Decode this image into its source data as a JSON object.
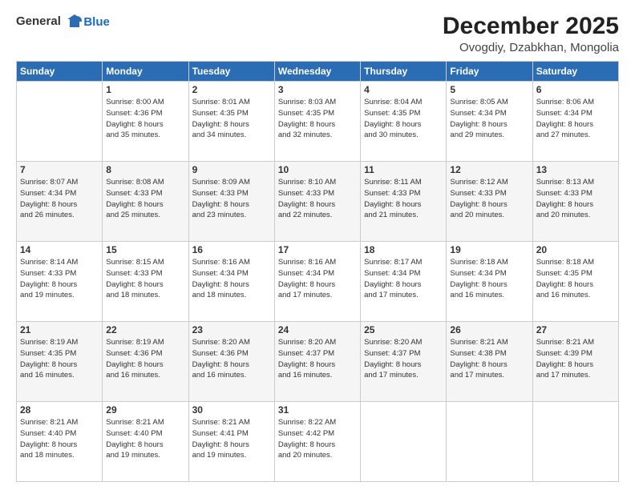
{
  "logo": {
    "general": "General",
    "blue": "Blue"
  },
  "header": {
    "month": "December 2025",
    "location": "Ovogdiy, Dzabkhan, Mongolia"
  },
  "weekdays": [
    "Sunday",
    "Monday",
    "Tuesday",
    "Wednesday",
    "Thursday",
    "Friday",
    "Saturday"
  ],
  "weeks": [
    [
      {
        "day": "",
        "info": ""
      },
      {
        "day": "1",
        "info": "Sunrise: 8:00 AM\nSunset: 4:36 PM\nDaylight: 8 hours\nand 35 minutes."
      },
      {
        "day": "2",
        "info": "Sunrise: 8:01 AM\nSunset: 4:35 PM\nDaylight: 8 hours\nand 34 minutes."
      },
      {
        "day": "3",
        "info": "Sunrise: 8:03 AM\nSunset: 4:35 PM\nDaylight: 8 hours\nand 32 minutes."
      },
      {
        "day": "4",
        "info": "Sunrise: 8:04 AM\nSunset: 4:35 PM\nDaylight: 8 hours\nand 30 minutes."
      },
      {
        "day": "5",
        "info": "Sunrise: 8:05 AM\nSunset: 4:34 PM\nDaylight: 8 hours\nand 29 minutes."
      },
      {
        "day": "6",
        "info": "Sunrise: 8:06 AM\nSunset: 4:34 PM\nDaylight: 8 hours\nand 27 minutes."
      }
    ],
    [
      {
        "day": "7",
        "info": "Sunrise: 8:07 AM\nSunset: 4:34 PM\nDaylight: 8 hours\nand 26 minutes."
      },
      {
        "day": "8",
        "info": "Sunrise: 8:08 AM\nSunset: 4:33 PM\nDaylight: 8 hours\nand 25 minutes."
      },
      {
        "day": "9",
        "info": "Sunrise: 8:09 AM\nSunset: 4:33 PM\nDaylight: 8 hours\nand 23 minutes."
      },
      {
        "day": "10",
        "info": "Sunrise: 8:10 AM\nSunset: 4:33 PM\nDaylight: 8 hours\nand 22 minutes."
      },
      {
        "day": "11",
        "info": "Sunrise: 8:11 AM\nSunset: 4:33 PM\nDaylight: 8 hours\nand 21 minutes."
      },
      {
        "day": "12",
        "info": "Sunrise: 8:12 AM\nSunset: 4:33 PM\nDaylight: 8 hours\nand 20 minutes."
      },
      {
        "day": "13",
        "info": "Sunrise: 8:13 AM\nSunset: 4:33 PM\nDaylight: 8 hours\nand 20 minutes."
      }
    ],
    [
      {
        "day": "14",
        "info": "Sunrise: 8:14 AM\nSunset: 4:33 PM\nDaylight: 8 hours\nand 19 minutes."
      },
      {
        "day": "15",
        "info": "Sunrise: 8:15 AM\nSunset: 4:33 PM\nDaylight: 8 hours\nand 18 minutes."
      },
      {
        "day": "16",
        "info": "Sunrise: 8:16 AM\nSunset: 4:34 PM\nDaylight: 8 hours\nand 18 minutes."
      },
      {
        "day": "17",
        "info": "Sunrise: 8:16 AM\nSunset: 4:34 PM\nDaylight: 8 hours\nand 17 minutes."
      },
      {
        "day": "18",
        "info": "Sunrise: 8:17 AM\nSunset: 4:34 PM\nDaylight: 8 hours\nand 17 minutes."
      },
      {
        "day": "19",
        "info": "Sunrise: 8:18 AM\nSunset: 4:34 PM\nDaylight: 8 hours\nand 16 minutes."
      },
      {
        "day": "20",
        "info": "Sunrise: 8:18 AM\nSunset: 4:35 PM\nDaylight: 8 hours\nand 16 minutes."
      }
    ],
    [
      {
        "day": "21",
        "info": "Sunrise: 8:19 AM\nSunset: 4:35 PM\nDaylight: 8 hours\nand 16 minutes."
      },
      {
        "day": "22",
        "info": "Sunrise: 8:19 AM\nSunset: 4:36 PM\nDaylight: 8 hours\nand 16 minutes."
      },
      {
        "day": "23",
        "info": "Sunrise: 8:20 AM\nSunset: 4:36 PM\nDaylight: 8 hours\nand 16 minutes."
      },
      {
        "day": "24",
        "info": "Sunrise: 8:20 AM\nSunset: 4:37 PM\nDaylight: 8 hours\nand 16 minutes."
      },
      {
        "day": "25",
        "info": "Sunrise: 8:20 AM\nSunset: 4:37 PM\nDaylight: 8 hours\nand 17 minutes."
      },
      {
        "day": "26",
        "info": "Sunrise: 8:21 AM\nSunset: 4:38 PM\nDaylight: 8 hours\nand 17 minutes."
      },
      {
        "day": "27",
        "info": "Sunrise: 8:21 AM\nSunset: 4:39 PM\nDaylight: 8 hours\nand 17 minutes."
      }
    ],
    [
      {
        "day": "28",
        "info": "Sunrise: 8:21 AM\nSunset: 4:40 PM\nDaylight: 8 hours\nand 18 minutes."
      },
      {
        "day": "29",
        "info": "Sunrise: 8:21 AM\nSunset: 4:40 PM\nDaylight: 8 hours\nand 19 minutes."
      },
      {
        "day": "30",
        "info": "Sunrise: 8:21 AM\nSunset: 4:41 PM\nDaylight: 8 hours\nand 19 minutes."
      },
      {
        "day": "31",
        "info": "Sunrise: 8:22 AM\nSunset: 4:42 PM\nDaylight: 8 hours\nand 20 minutes."
      },
      {
        "day": "",
        "info": ""
      },
      {
        "day": "",
        "info": ""
      },
      {
        "day": "",
        "info": ""
      }
    ]
  ]
}
